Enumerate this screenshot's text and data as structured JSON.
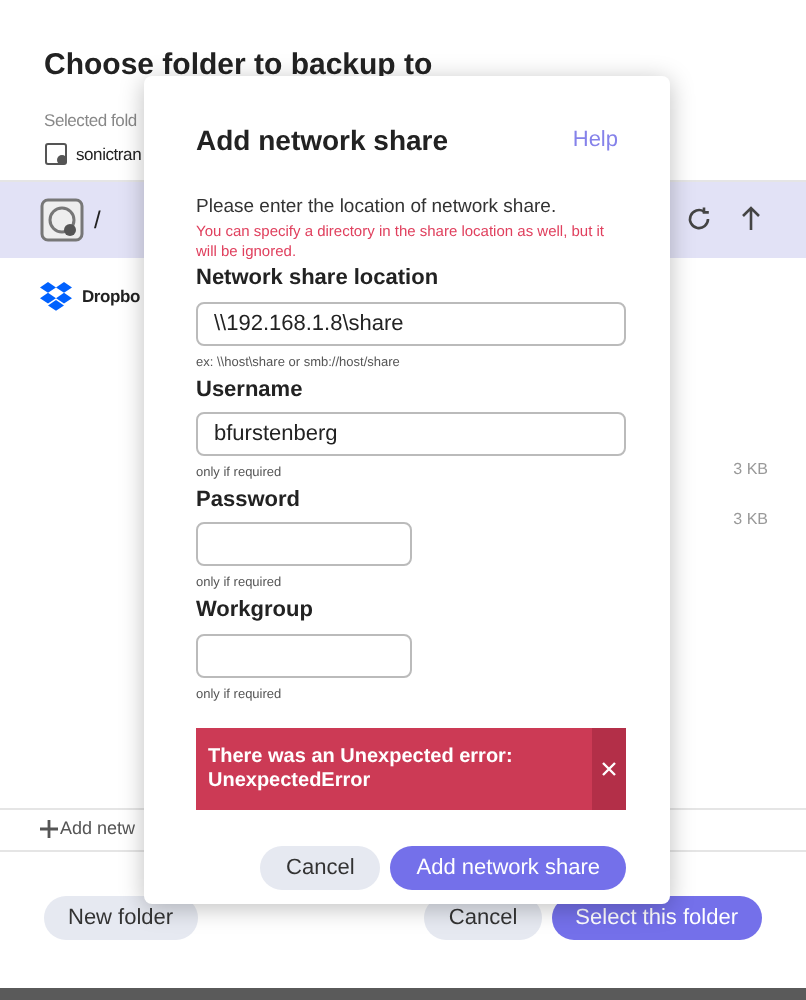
{
  "background": {
    "title": "Choose folder to backup to",
    "selected_label": "Selected fold",
    "selected_folder": "sonictran",
    "locations": [
      {
        "kind": "disk",
        "label": "/",
        "selected": true
      },
      {
        "kind": "dropbox",
        "label": "Dropbo",
        "selected": false
      }
    ],
    "sizes": [
      "3 KB",
      "3 KB"
    ],
    "add_link": "Add netw",
    "buttons": [
      {
        "kind": "secondary",
        "label": "New folder"
      },
      {
        "kind": "secondary",
        "label": "Cancel"
      },
      {
        "kind": "primary",
        "label": "Select this folder"
      }
    ]
  },
  "dialog": {
    "title": "Add network share",
    "help": "Help",
    "intro": "Please enter the location of network share.",
    "note": "You can specify a directory in the share location as well, but it will be ignored.",
    "fields": [
      {
        "label": "Network share location",
        "value": "\\\\192.168.1.8\\share",
        "hint": "ex: \\\\host\\share or smb://host/share"
      },
      {
        "label": "Username",
        "value": "bfurstenberg",
        "hint": "only if required"
      },
      {
        "label": "Password",
        "hint": "only if required"
      },
      {
        "label": "Workgroup",
        "hint": "only if required"
      }
    ],
    "error": "There was an Unexpected error: UnexpectedError",
    "buttons": [
      {
        "kind": "secondary",
        "label": "Cancel"
      },
      {
        "kind": "primary",
        "label": "Add network share"
      }
    ]
  }
}
